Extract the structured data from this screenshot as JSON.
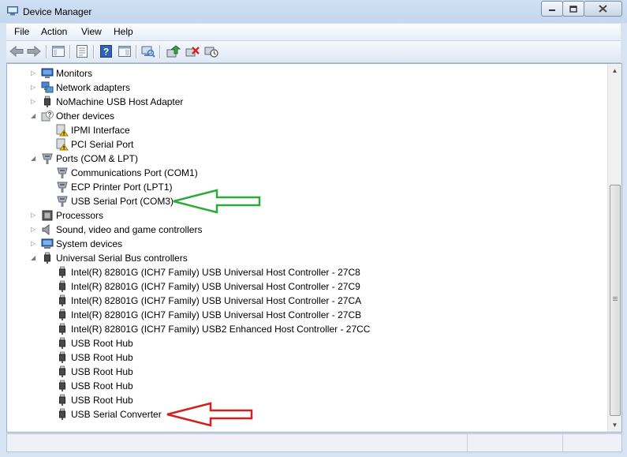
{
  "window": {
    "title": "Device Manager",
    "minimize_icon": "minimize-icon",
    "maximize_icon": "maximize-icon",
    "close_icon": "close-icon"
  },
  "menu": [
    "File",
    "Action",
    "View",
    "Help"
  ],
  "toolbar": {
    "buttons": [
      "back-arrow-icon",
      "forward-arrow-icon",
      "show-hide-console-tree-icon",
      "properties-icon",
      "help-icon",
      "action-pane-icon",
      "scan-hardware-icon",
      "update-driver-icon",
      "uninstall-icon",
      "disable-device-icon"
    ]
  },
  "tree": {
    "items": [
      {
        "label": "Monitors",
        "icon": "monitor-icon",
        "expander": "collapsed"
      },
      {
        "label": "Network adapters",
        "icon": "network-adapter-icon",
        "expander": "collapsed"
      },
      {
        "label": "NoMachine USB Host Adapter",
        "icon": "usb-plug-icon",
        "expander": "collapsed"
      },
      {
        "label": "Other devices",
        "icon": "unknown-device-icon",
        "expander": "expanded"
      },
      {
        "label": "IPMI Interface",
        "icon": "warning-device-icon",
        "expander": "none"
      },
      {
        "label": "PCI Serial Port",
        "icon": "warning-device-icon",
        "expander": "none"
      },
      {
        "label": "Ports (COM & LPT)",
        "icon": "port-icon",
        "expander": "expanded"
      },
      {
        "label": "Communications Port (COM1)",
        "icon": "port-icon",
        "expander": "none"
      },
      {
        "label": "ECP Printer Port (LPT1)",
        "icon": "port-icon",
        "expander": "none"
      },
      {
        "label": "USB Serial Port (COM3)",
        "icon": "port-icon",
        "expander": "none"
      },
      {
        "label": "Processors",
        "icon": "processor-icon",
        "expander": "collapsed"
      },
      {
        "label": "Sound, video and game controllers",
        "icon": "speaker-icon",
        "expander": "collapsed"
      },
      {
        "label": "System devices",
        "icon": "system-device-icon",
        "expander": "collapsed"
      },
      {
        "label": "Universal Serial Bus controllers",
        "icon": "usb-plug-icon",
        "expander": "expanded"
      },
      {
        "label": "Intel(R) 82801G (ICH7 Family) USB Universal Host Controller - 27C8",
        "icon": "usb-plug-icon",
        "expander": "none"
      },
      {
        "label": "Intel(R) 82801G (ICH7 Family) USB Universal Host Controller - 27C9",
        "icon": "usb-plug-icon",
        "expander": "none"
      },
      {
        "label": "Intel(R) 82801G (ICH7 Family) USB Universal Host Controller - 27CA",
        "icon": "usb-plug-icon",
        "expander": "none"
      },
      {
        "label": "Intel(R) 82801G (ICH7 Family) USB Universal Host Controller - 27CB",
        "icon": "usb-plug-icon",
        "expander": "none"
      },
      {
        "label": "Intel(R) 82801G (ICH7 Family) USB2 Enhanced Host Controller - 27CC",
        "icon": "usb-plug-icon",
        "expander": "none"
      },
      {
        "label": "USB Root Hub",
        "icon": "usb-plug-icon",
        "expander": "none"
      },
      {
        "label": "USB Root Hub",
        "icon": "usb-plug-icon",
        "expander": "none"
      },
      {
        "label": "USB Root Hub",
        "icon": "usb-plug-icon",
        "expander": "none"
      },
      {
        "label": "USB Root Hub",
        "icon": "usb-plug-icon",
        "expander": "none"
      },
      {
        "label": "USB Root Hub",
        "icon": "usb-plug-icon",
        "expander": "none"
      },
      {
        "label": "USB Serial Converter",
        "icon": "usb-plug-icon",
        "expander": "none"
      }
    ]
  },
  "annotations": {
    "green_arrow_color": "#2eaa3a",
    "red_arrow_color": "#d21f1f"
  },
  "colors": {
    "titlebar": "#c4d7ee",
    "tree_bg": "#ffffff"
  }
}
